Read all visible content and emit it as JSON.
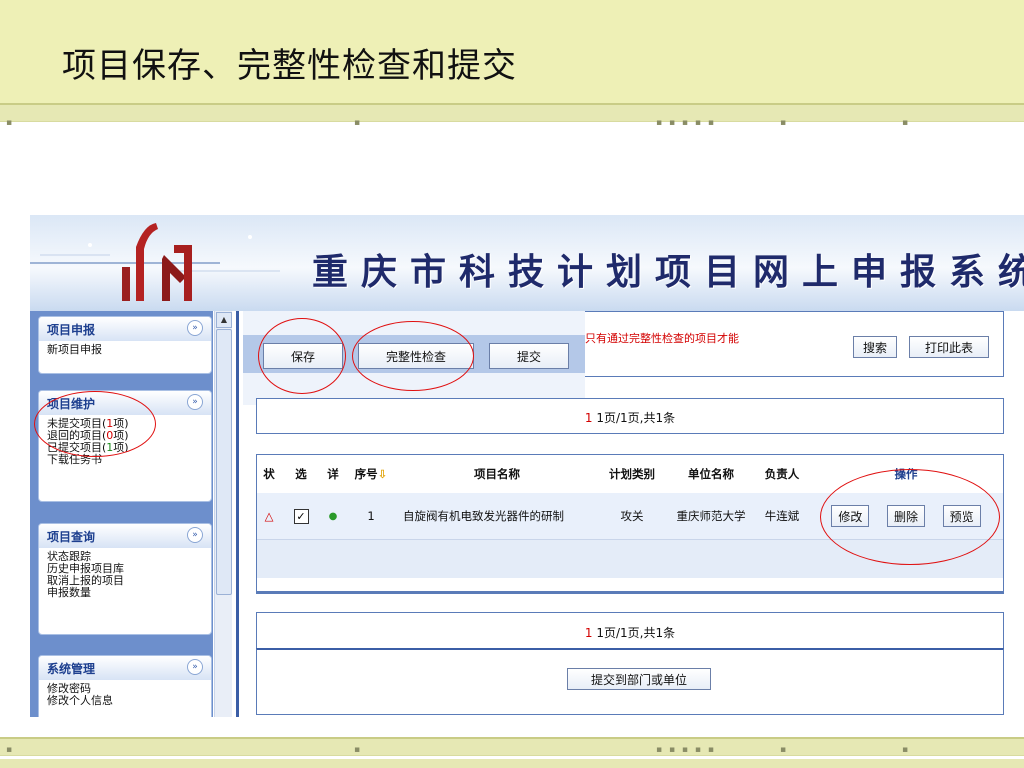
{
  "slide": {
    "title": "项目保存、完整性检查和提交"
  },
  "app": {
    "system_title": "重庆市科技计划项目网上申报系统",
    "sidebar": {
      "panels": [
        {
          "title": "项目申报",
          "items": [
            "新项目申报"
          ]
        },
        {
          "title": "项目维护",
          "items": [
            {
              "text": "未提交项目",
              "count": "1"
            },
            {
              "text": "退回的项目",
              "count": "0"
            },
            {
              "text": "已提交项目",
              "count": "1"
            },
            {
              "text": "下载任务书"
            }
          ]
        },
        {
          "title": "项目查询",
          "items": [
            "状态跟踪",
            "历史申报项目库",
            "取消上报的项目",
            "申报数量"
          ]
        },
        {
          "title": "系统管理",
          "items": [
            "修改密码",
            "修改个人信息"
          ]
        }
      ],
      "toggle_glyph": "»",
      "open_paren": "(",
      "close_paren": "项)"
    },
    "toolbar": {
      "save": "保存",
      "integrity_check": "完整性检查",
      "submit": "提交"
    },
    "notice": "只有通过完整性检查的项目才能",
    "search_button": "搜索",
    "print_button": "打印此表",
    "pager": {
      "current": "1",
      "text": "1页/1页,共1条"
    },
    "table": {
      "columns": [
        "状",
        "选",
        "详",
        "序号",
        "项目名称",
        "计划类别",
        "单位名称",
        "负责人",
        "操作"
      ],
      "rows": [
        {
          "status": "△",
          "checked": "✓",
          "detail": "●",
          "seq": "1",
          "name": "自旋阀有机电致发光器件的研制",
          "plan": "攻关",
          "unit": "重庆师范大学",
          "leader": "牛连斌"
        }
      ],
      "actions": [
        "修改",
        "删除",
        "预览"
      ]
    },
    "submit_dept_button": "提交到部门或单位"
  }
}
